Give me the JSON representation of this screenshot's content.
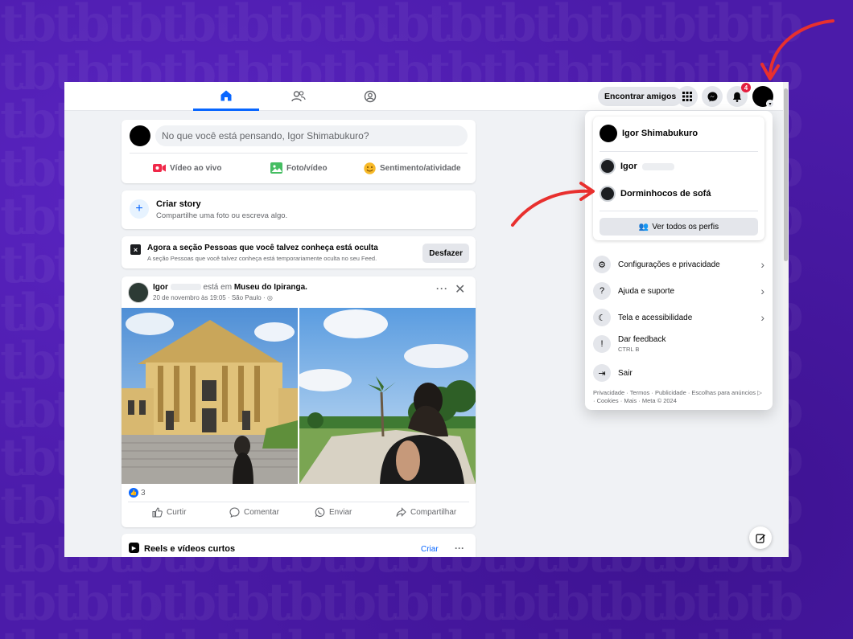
{
  "topbar": {
    "find_friends": "Encontrar amigos",
    "notification_count": "4",
    "tabs": [
      "home-icon",
      "friends-icon",
      "groups-icon"
    ]
  },
  "composer": {
    "placeholder": "No que você está pensando, Igor Shimabukuro?",
    "actions": [
      {
        "label": "Vídeo ao vivo",
        "icon": "live-video-icon",
        "color": "#f02849"
      },
      {
        "label": "Foto/vídeo",
        "icon": "photo-icon",
        "color": "#45bd62"
      },
      {
        "label": "Sentimento/atividade",
        "icon": "feeling-icon",
        "color": "#f7b928"
      }
    ]
  },
  "story": {
    "title": "Criar story",
    "subtitle": "Compartilhe uma foto ou escreva algo."
  },
  "hidden_notice": {
    "title": "Agora a seção Pessoas que você talvez conheça está oculta",
    "subtitle": "A seção Pessoas que você talvez conheça está temporariamente oculta no seu Feed.",
    "undo": "Desfazer"
  },
  "post": {
    "author": "Igor",
    "verb": "está em",
    "place": "Museu do Ipiranga.",
    "meta": "20 de novembro às 19:05 · São Paulo ·",
    "reactions": "3",
    "actions": [
      "Curtir",
      "Comentar",
      "Enviar",
      "Compartilhar"
    ]
  },
  "reels": {
    "title": "Reels e vídeos curtos",
    "create": "Criar"
  },
  "menu": {
    "main_profile": "Igor Shimabukuro",
    "profiles": [
      "Igor",
      "Dorminhocos de sofá"
    ],
    "see_all": "Ver todos os perfis",
    "items": [
      {
        "label": "Configurações e privacidade",
        "icon": "gear-icon",
        "arrow": true
      },
      {
        "label": "Ajuda e suporte",
        "icon": "help-icon",
        "arrow": true
      },
      {
        "label": "Tela e acessibilidade",
        "icon": "moon-icon",
        "arrow": true
      },
      {
        "label": "Dar feedback",
        "sub": "CTRL B",
        "icon": "feedback-icon",
        "arrow": false
      },
      {
        "label": "Sair",
        "icon": "logout-icon",
        "arrow": false
      }
    ],
    "footer": "Privacidade · Termos · Publicidade · Escolhas para anúncios ▷ · Cookies · Mais · Meta © 2024"
  },
  "colors": {
    "accent": "#0866ff",
    "background": "#4b1ba9",
    "annotation_arrow": "#e8302e"
  }
}
